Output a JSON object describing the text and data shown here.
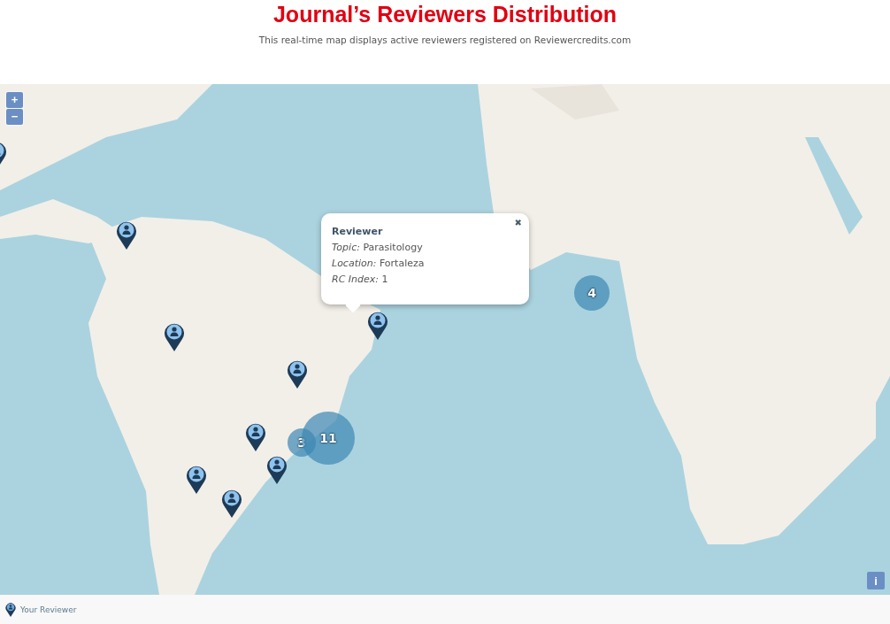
{
  "header": {
    "title": "Journal’s Reviewers Distribution",
    "subtitle": "This real-time map displays active reviewers registered on Reviewercredits.com"
  },
  "map": {
    "zoom_in": "+",
    "zoom_out": "−",
    "info": "i",
    "popup": {
      "title": "Reviewer",
      "close": "✖",
      "lines": [
        "*Topic:* Parasitology",
        "*Location:* Fortaleza",
        "*RC Index:* 1"
      ]
    },
    "clusters": [
      {
        "count": "4"
      },
      {
        "count": "3"
      },
      {
        "count": "11"
      }
    ]
  },
  "legend": {
    "label": "Your Reviewer"
  }
}
